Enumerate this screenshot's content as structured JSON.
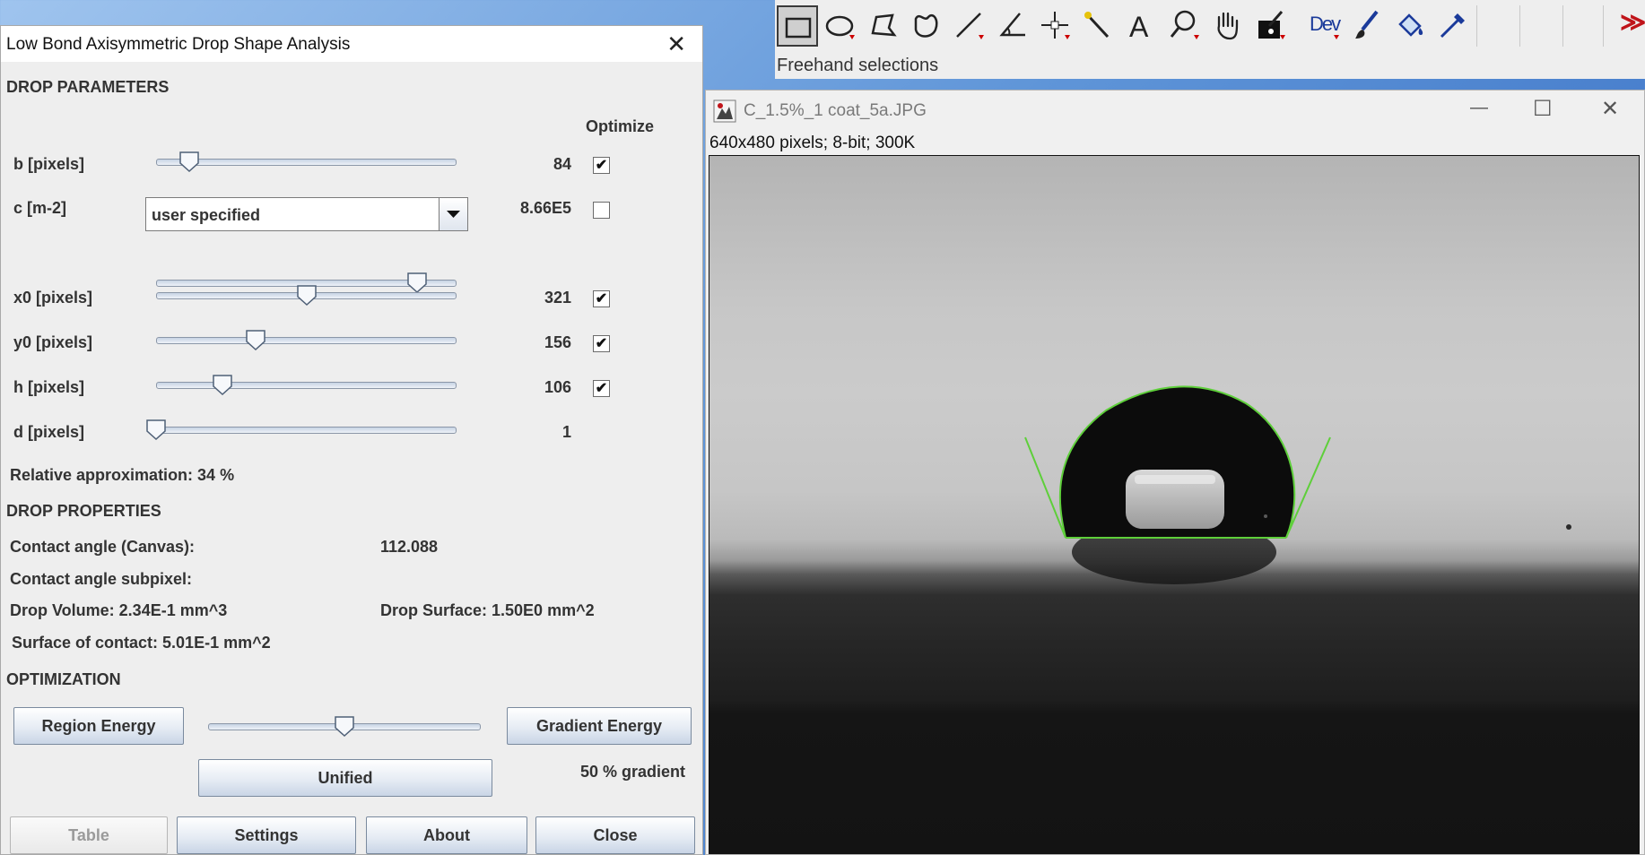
{
  "dialog": {
    "title": "Low Bond Axisymmetric Drop Shape Analysis",
    "close_glyph": "✕",
    "drop_parameters": {
      "heading": "DROP PARAMETERS",
      "optimize_header": "Optimize",
      "rows": [
        {
          "label": "b [pixels]",
          "value": "84",
          "slider_fraction": 0.11,
          "optimize": true
        },
        {
          "label": "c [m-2]",
          "value": "8.66E5",
          "mode": "user specified",
          "slider_fraction": 0.87,
          "optimize": false
        },
        {
          "label": "x0 [pixels]",
          "value": "321",
          "slider_fraction": 0.5,
          "optimize": true
        },
        {
          "label": "y0 [pixels]",
          "value": "156",
          "slider_fraction": 0.33,
          "optimize": true
        },
        {
          "label": "h [pixels]",
          "value": "106",
          "slider_fraction": 0.22,
          "optimize": true
        },
        {
          "label": "d [pixels]",
          "value": "1",
          "slider_fraction": 0.0
        }
      ],
      "relative_approximation": "Relative approximation: 34 %"
    },
    "drop_properties": {
      "heading": "DROP PROPERTIES",
      "contact_angle_canvas_label": "Contact angle (Canvas):",
      "contact_angle_canvas_value": "112.088",
      "contact_angle_subpixel_label": "Contact angle subpixel:",
      "drop_volume": "Drop Volume: 2.34E-1 mm^3",
      "drop_surface": "Drop Surface: 1.50E0 mm^2",
      "surface_of_contact": "Surface of contact: 5.01E-1 mm^2"
    },
    "optimization": {
      "heading": "OPTIMIZATION",
      "region_energy": "Region Energy",
      "gradient_energy": "Gradient Energy",
      "unified": "Unified",
      "gradient_text": "50 % gradient",
      "slider_fraction": 0.5
    },
    "buttons": {
      "table": "Table",
      "settings": "Settings",
      "about": "About",
      "close": "Close"
    }
  },
  "toolbar": {
    "tools": [
      "rectangle-tool",
      "oval-tool",
      "polygon-tool",
      "freehand-tool",
      "line-tool",
      "angle-tool",
      "point-tool",
      "wand-tool",
      "text-tool",
      "magnifier-tool",
      "hand-tool",
      "color-picker-tool",
      "dev-tool",
      "brush-tool",
      "fill-tool",
      "pipette-tool"
    ],
    "dev_label": "Dev",
    "status": "Freehand selections",
    "more_glyph": "≫"
  },
  "image_window": {
    "title": "C_1.5%_1 coat_5a.JPG",
    "info": "640x480 pixels; 8-bit; 300K",
    "minimize_glyph": "—",
    "maximize_glyph": "☐",
    "close_glyph": "✕"
  },
  "colors": {
    "fit_overlay": "#5ecf3a",
    "drop_fill": "#0c0c0c"
  }
}
